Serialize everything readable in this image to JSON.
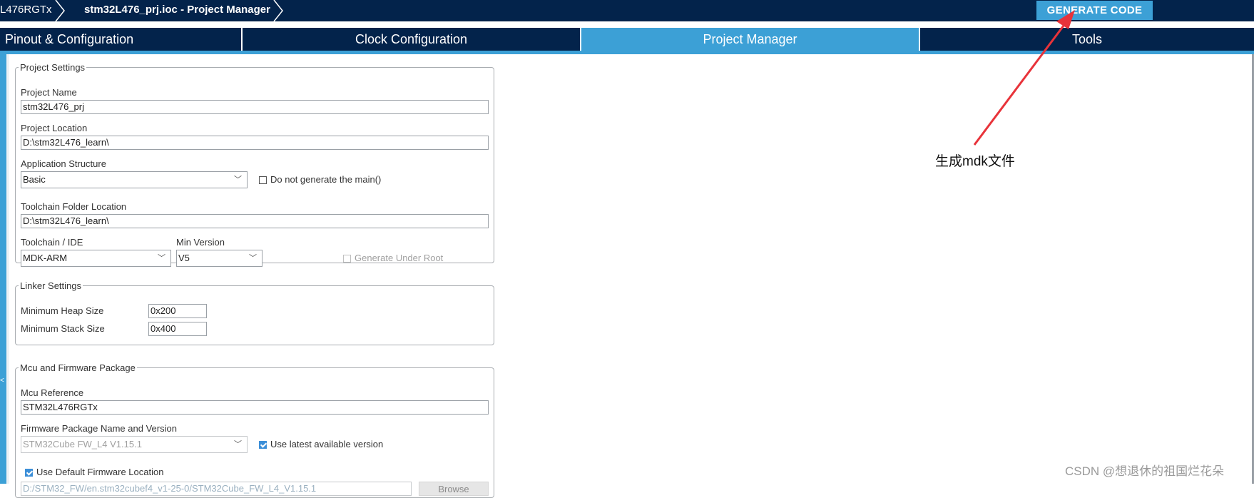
{
  "breadcrumb": {
    "device": "L476RGTx",
    "file": "stm32L476_prj.ioc - Project Manager"
  },
  "generate_label": "GENERATE CODE",
  "tabs": [
    {
      "label": "Pinout & Configuration"
    },
    {
      "label": "Clock Configuration"
    },
    {
      "label": "Project Manager"
    },
    {
      "label": "Tools"
    }
  ],
  "active_tab": "Project Manager",
  "project_settings": {
    "legend": "Project Settings",
    "project_name_label": "Project Name",
    "project_name": "stm32L476_prj",
    "project_location_label": "Project Location",
    "project_location": "D:\\stm32L476_learn\\",
    "app_structure_label": "Application Structure",
    "app_structure": "Basic",
    "no_main_label": "Do not generate the main()",
    "no_main_checked": false,
    "toolchain_folder_label": "Toolchain Folder Location",
    "toolchain_folder": "D:\\stm32L476_learn\\",
    "toolchain_label": "Toolchain / IDE",
    "toolchain": "MDK-ARM",
    "min_version_label": "Min Version",
    "min_version": "V5",
    "gen_under_root_label": "Generate Under Root",
    "gen_under_root_checked": false
  },
  "linker_settings": {
    "legend": "Linker Settings",
    "heap_label": "Minimum Heap Size",
    "heap": "0x200",
    "stack_label": "Minimum Stack Size",
    "stack": "0x400"
  },
  "mcu_firmware": {
    "legend": "Mcu and Firmware Package",
    "mcu_ref_label": "Mcu Reference",
    "mcu_ref": "STM32L476RGTx",
    "fw_label": "Firmware Package Name and Version",
    "fw": "STM32Cube FW_L4 V1.15.1",
    "use_latest_label": "Use latest available version",
    "use_latest_checked": true,
    "use_default_label": "Use Default Firmware Location",
    "use_default_checked": true,
    "fw_location": "D:/STM32_FW/en.stm32cubef4_v1-25-0/STM32Cube_FW_L4_V1.15.1",
    "browse_label": "Browse"
  },
  "annotation": "生成mdk文件",
  "watermark": "CSDN @想退休的祖国烂花朵",
  "colors": {
    "navy": "#03234b",
    "accent": "#3ca0d6",
    "arrow": "#e8333a"
  }
}
